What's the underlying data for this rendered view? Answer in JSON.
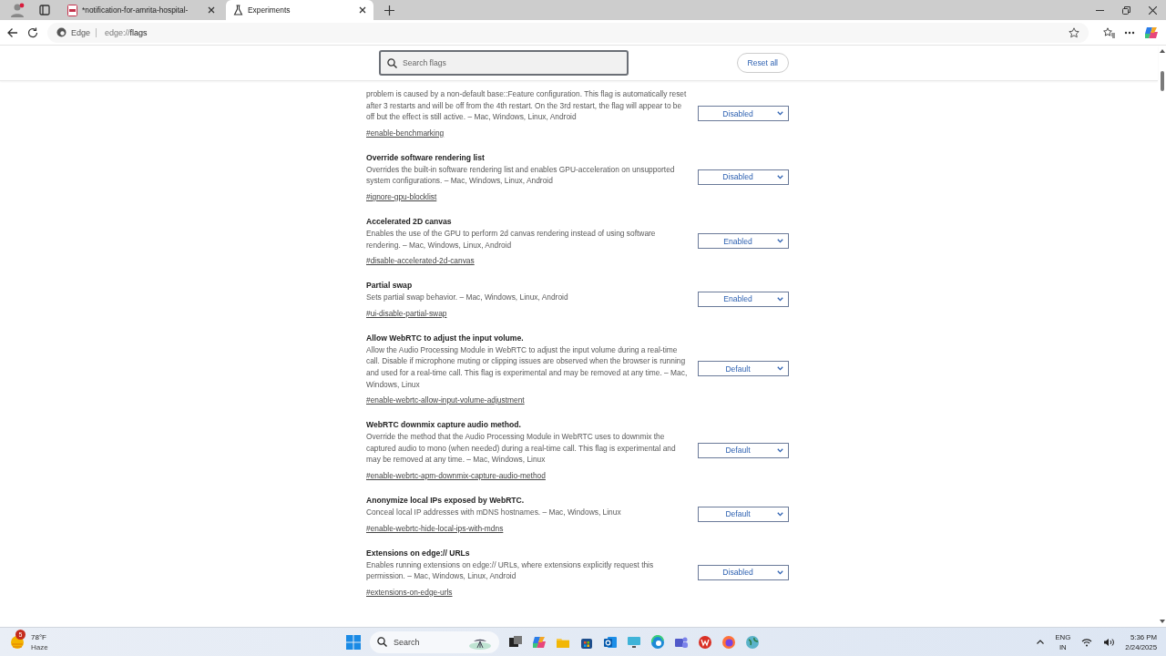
{
  "browser": {
    "tabs": [
      {
        "title": "*notification-for-amrita-hospital-",
        "kind": "pdf",
        "selected": false
      },
      {
        "title": "Experiments",
        "kind": "flask",
        "selected": true
      }
    ],
    "address": {
      "site": "Edge",
      "url_prefix": "edge://",
      "url_path": "flags"
    }
  },
  "flags_page": {
    "search": {
      "placeholder": "Search flags"
    },
    "reset_button": "Reset all",
    "flags": [
      {
        "description": "problem is caused by a non-default base::Feature configuration. This flag is automatically reset after 3 restarts and will be off from the 4th restart. On the 3rd restart, the flag will appear to be off but the effect is still active. – Mac, Windows, Linux, Android",
        "link": "#enable-benchmarking",
        "value": "Disabled"
      },
      {
        "title": "Override software rendering list",
        "description": "Overrides the built-in software rendering list and enables GPU-acceleration on unsupported system configurations. – Mac, Windows, Linux, Android",
        "link": "#ignore-gpu-blocklist",
        "value": "Disabled"
      },
      {
        "title": "Accelerated 2D canvas",
        "description": "Enables the use of the GPU to perform 2d canvas rendering instead of using software rendering. – Mac, Windows, Linux, Android",
        "link": "#disable-accelerated-2d-canvas",
        "value": "Enabled"
      },
      {
        "title": "Partial swap",
        "description": "Sets partial swap behavior. – Mac, Windows, Linux, Android",
        "link": "#ui-disable-partial-swap",
        "value": "Enabled"
      },
      {
        "title": "Allow WebRTC to adjust the input volume.",
        "description": "Allow the Audio Processing Module in WebRTC to adjust the input volume during a real-time call. Disable if microphone muting or clipping issues are observed when the browser is running and used for a real-time call. This flag is experimental and may be removed at any time. – Mac, Windows, Linux",
        "link": "#enable-webrtc-allow-input-volume-adjustment",
        "value": "Default"
      },
      {
        "title": "WebRTC downmix capture audio method.",
        "description": "Override the method that the Audio Processing Module in WebRTC uses to downmix the captured audio to mono (when needed) during a real-time call. This flag is experimental and may be removed at any time. – Mac, Windows, Linux",
        "link": "#enable-webrtc-apm-downmix-capture-audio-method",
        "value": "Default"
      },
      {
        "title": "Anonymize local IPs exposed by WebRTC.",
        "description": "Conceal local IP addresses with mDNS hostnames. – Mac, Windows, Linux",
        "link": "#enable-webrtc-hide-local-ips-with-mdns",
        "value": "Default"
      },
      {
        "title": "Extensions on edge:// URLs",
        "description": "Enables running extensions on edge:// URLs, where extensions explicitly request this permission. – Mac, Windows, Linux, Android",
        "link": "#extensions-on-edge-urls",
        "value": "Disabled"
      }
    ]
  },
  "taskbar": {
    "weather": {
      "badge": "5",
      "temperature": "78°F",
      "condition": "Haze"
    },
    "search": {
      "placeholder": "Search"
    },
    "language": {
      "code": "ENG",
      "region": "IN"
    },
    "time": "5:36 PM",
    "date": "2/24/2025"
  }
}
